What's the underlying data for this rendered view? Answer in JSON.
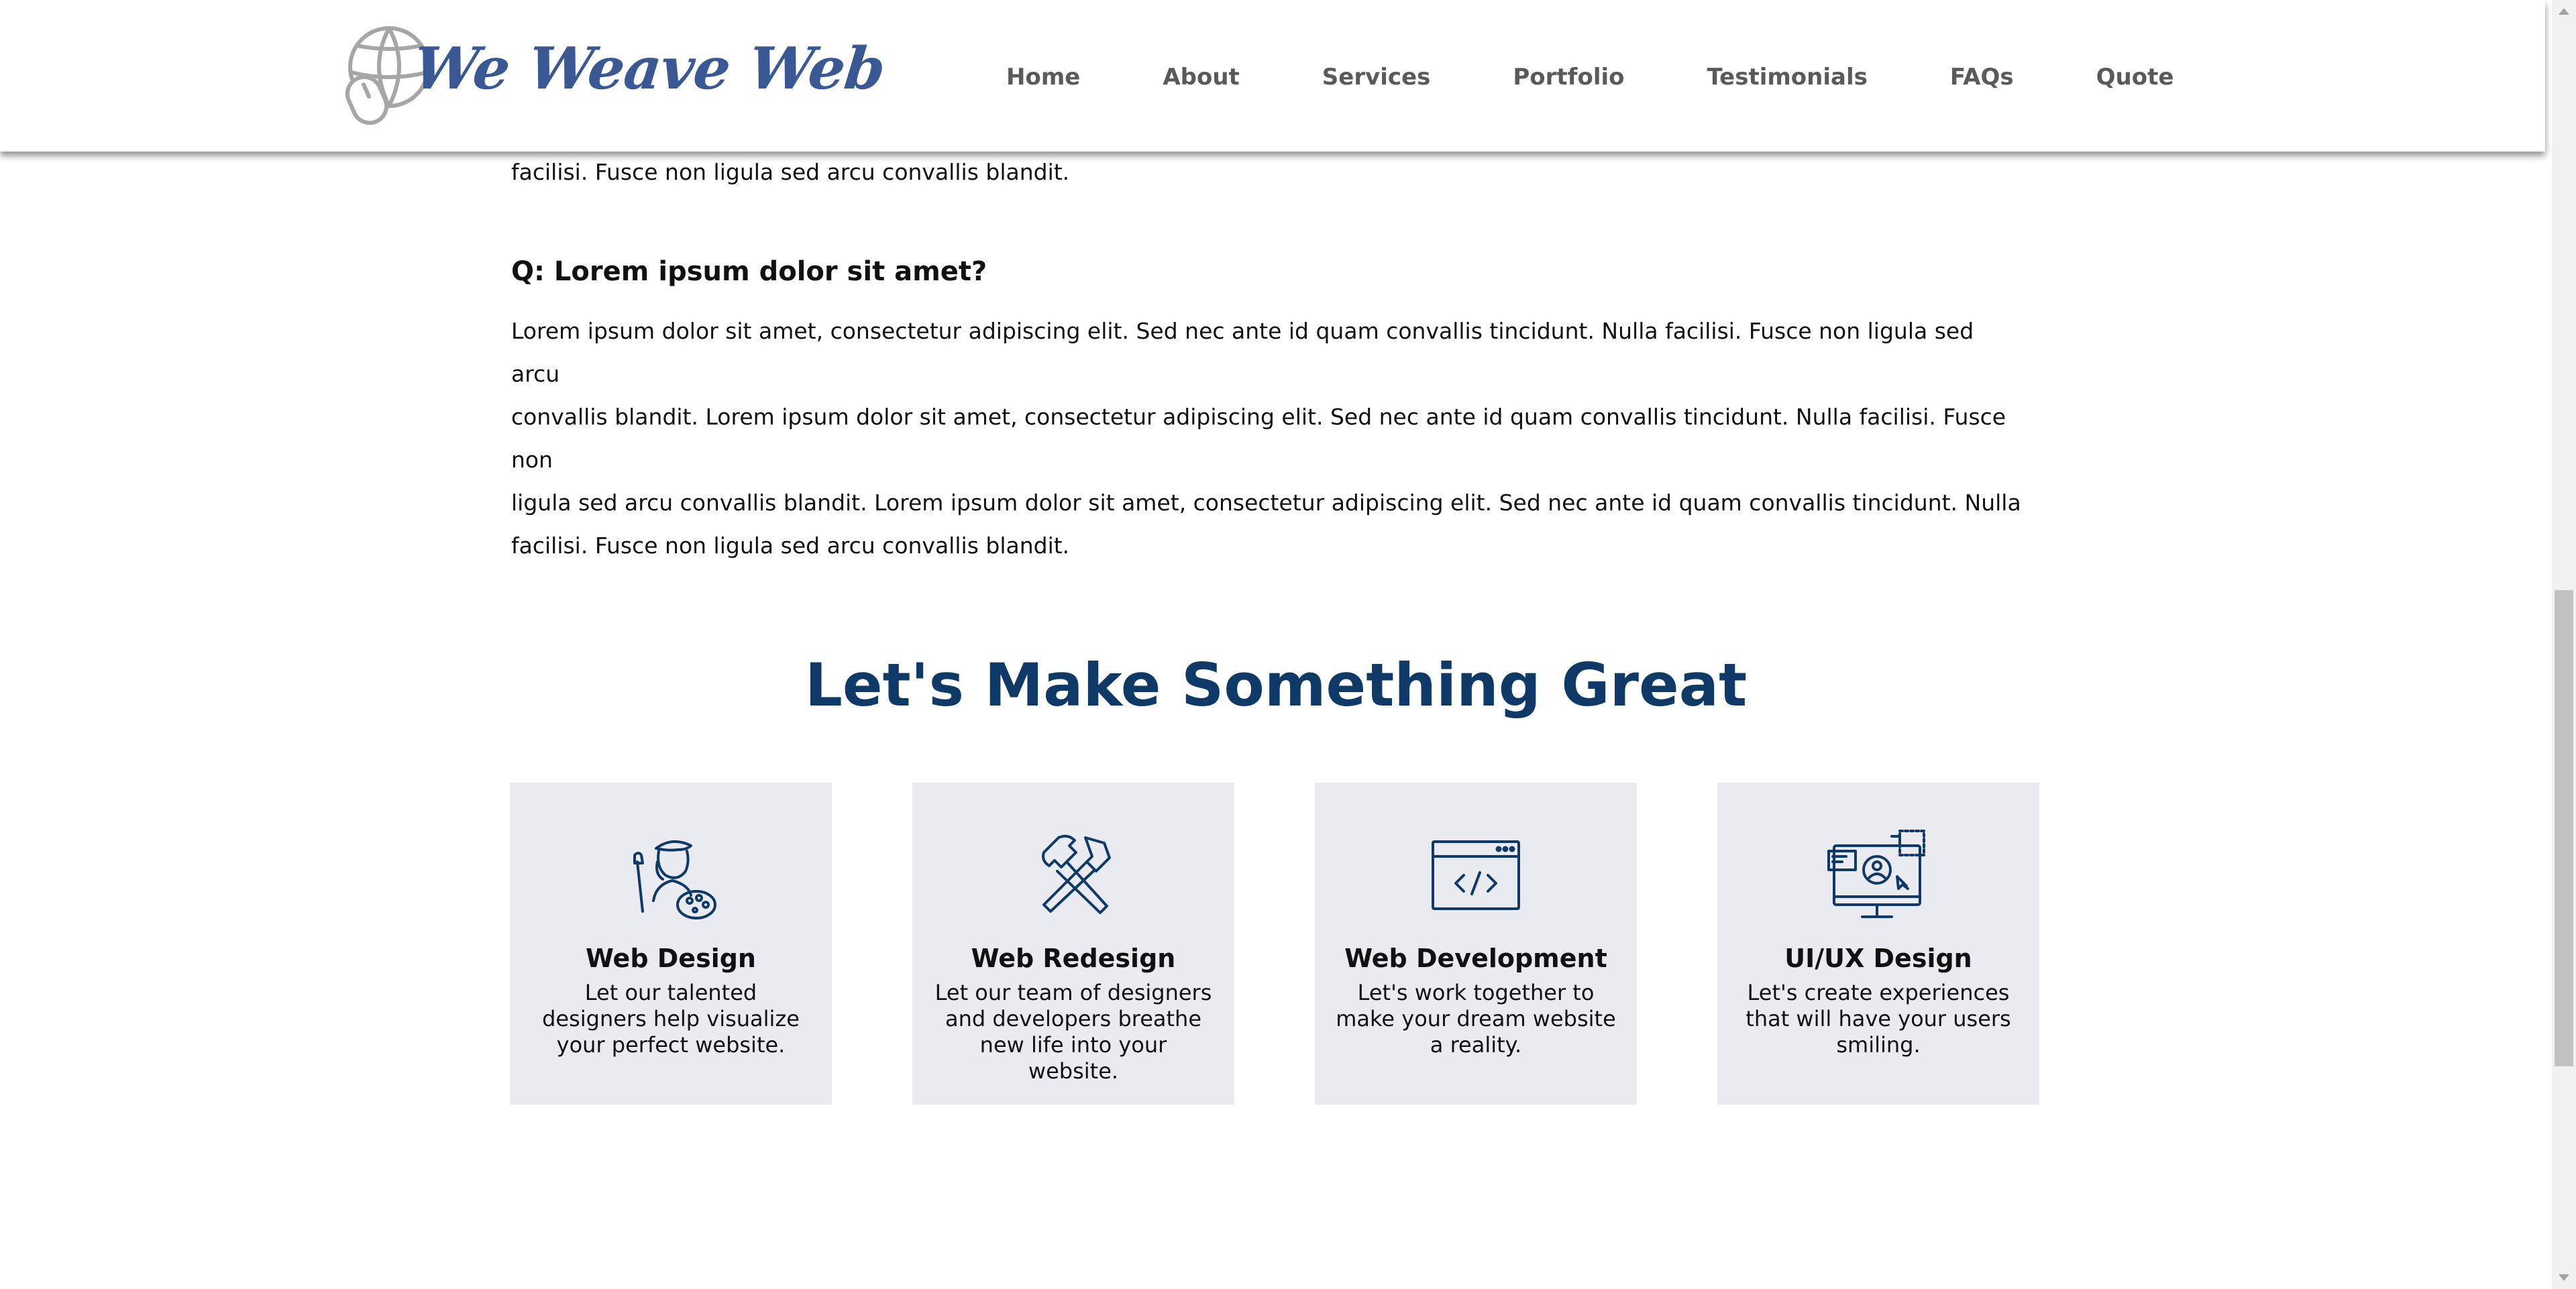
{
  "header": {
    "logo_text": "We Weave Web",
    "nav": [
      "Home",
      "About",
      "Services",
      "Portfolio",
      "Testimonials",
      "FAQs",
      "Quote"
    ]
  },
  "faq": [
    {
      "answer_tail": "facilisi. Fusce non ligula sed arcu convallis blandit."
    },
    {
      "question": "Q: Lorem ipsum dolor sit amet?",
      "answer_lines": [
        "Lorem ipsum dolor sit amet, consectetur adipiscing elit. Sed nec ante id quam convallis tincidunt. Nulla facilisi. Fusce non ligula sed arcu",
        "convallis blandit. Lorem ipsum dolor sit amet, consectetur adipiscing elit. Sed nec ante id quam convallis tincidunt. Nulla facilisi. Fusce non",
        "ligula sed arcu convallis blandit. Lorem ipsum dolor sit amet, consectetur adipiscing elit. Sed nec ante id quam convallis tincidunt. Nulla",
        "facilisi. Fusce non ligula sed arcu convallis blandit."
      ]
    }
  ],
  "services": {
    "title": "Let's Make Something Great",
    "cards": [
      {
        "icon": "artist-icon",
        "title": "Web Design",
        "text": "Let our talented designers help visualize your perfect website."
      },
      {
        "icon": "hammer-wrench-icon",
        "title": "Web Redesign",
        "text": "Let our team of designers and developers breathe new life into your website."
      },
      {
        "icon": "code-window-icon",
        "title": "Web Development",
        "text": "Let's work together to make your dream website a reality."
      },
      {
        "icon": "monitor-ux-icon",
        "title": "UI/UX Design",
        "text": "Let's create experiences that will have your users smiling."
      }
    ]
  },
  "colors": {
    "brand_blue": "#3a5893",
    "heading_navy": "#0f3a67",
    "card_bg": "#e9ebf0",
    "nav_gray": "#5a5a5a"
  }
}
